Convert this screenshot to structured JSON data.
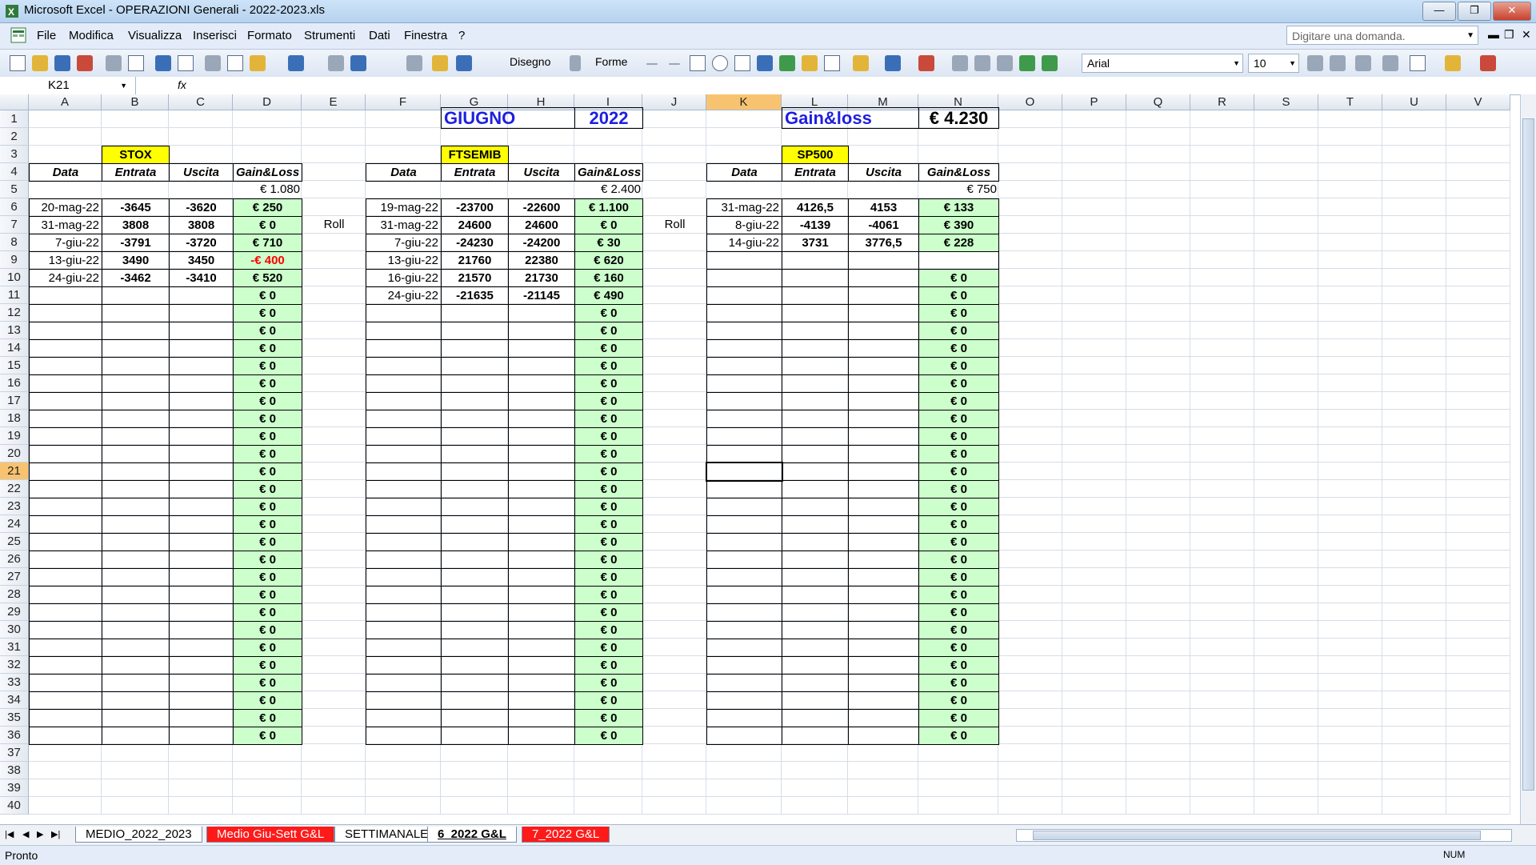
{
  "window": {
    "title": "Microsoft Excel - OPERAZIONI Generali - 2022-2023.xls"
  },
  "menu": [
    "File",
    "Modifica",
    "Visualizza",
    "Inserisci",
    "Formato",
    "Strumenti",
    "Dati",
    "Finestra",
    "?"
  ],
  "ask_placeholder": "Digitare una domanda.",
  "toolbar": {
    "draw": "Disegno",
    "shapes": "Forme",
    "font": "Arial",
    "size": "10"
  },
  "namebox": "K21",
  "columns": [
    "A",
    "B",
    "C",
    "D",
    "E",
    "F",
    "G",
    "H",
    "I",
    "J",
    "K",
    "L",
    "M",
    "N",
    "O",
    "P",
    "Q",
    "R",
    "S",
    "T",
    "U",
    "V"
  ],
  "rows": [
    "1",
    "2",
    "3",
    "4",
    "5",
    "6",
    "7",
    "8",
    "9",
    "10",
    "11",
    "12",
    "13",
    "14",
    "15",
    "16",
    "17",
    "18",
    "19",
    "20",
    "21",
    "22",
    "23",
    "24",
    "25",
    "26",
    "27",
    "28",
    "29",
    "30",
    "31",
    "32",
    "33",
    "34",
    "35",
    "36",
    "37",
    "38",
    "39",
    "40"
  ],
  "header": {
    "month": "GIUGNO",
    "year": "2022",
    "gl_label": "Gain&loss",
    "gl_total": "€ 4.230"
  },
  "stox": {
    "title": "STOX",
    "cols": [
      "Data",
      "Entrata",
      "Uscita",
      "Gain&Loss"
    ],
    "total": "€ 1.080",
    "roll": "Roll",
    "rows": [
      [
        "20-mag-22",
        "-3645",
        "-3620",
        "€ 250"
      ],
      [
        "31-mag-22",
        "3808",
        "3808",
        "€ 0"
      ],
      [
        "7-giu-22",
        "-3791",
        "-3720",
        "€ 710"
      ],
      [
        "13-giu-22",
        "3490",
        "3450",
        "-€ 400"
      ],
      [
        "24-giu-22",
        "-3462",
        "-3410",
        "€ 520"
      ]
    ]
  },
  "ftsemib": {
    "title": "FTSEMIB",
    "cols": [
      "Data",
      "Entrata",
      "Uscita",
      "Gain&Loss"
    ],
    "total": "€ 2.400",
    "roll": "Roll",
    "rows": [
      [
        "19-mag-22",
        "-23700",
        "-22600",
        "€ 1.100"
      ],
      [
        "31-mag-22",
        "24600",
        "24600",
        "€ 0"
      ],
      [
        "7-giu-22",
        "-24230",
        "-24200",
        "€ 30"
      ],
      [
        "13-giu-22",
        "21760",
        "22380",
        "€ 620"
      ],
      [
        "16-giu-22",
        "21570",
        "21730",
        "€ 160"
      ],
      [
        "24-giu-22",
        "-21635",
        "-21145",
        "€ 490"
      ]
    ]
  },
  "sp500": {
    "title": "SP500",
    "cols": [
      "Data",
      "Entrata",
      "Uscita",
      "Gain&Loss"
    ],
    "total": "€ 750",
    "rows": [
      [
        "31-mag-22",
        "4126,5",
        "4153",
        "€ 133"
      ],
      [
        "8-giu-22",
        "-4139",
        "-4061",
        "€ 390"
      ],
      [
        "14-giu-22",
        "3731",
        "3776,5",
        "€ 228"
      ]
    ]
  },
  "zero": "€ 0",
  "sheets": [
    "MEDIO_2022_2023",
    "Medio Giu-Sett G&L",
    "SETTIMANALE",
    "6_2022 G&L",
    "7_2022 G&L"
  ],
  "status": {
    "ready": "Pronto",
    "num": "NUM"
  }
}
